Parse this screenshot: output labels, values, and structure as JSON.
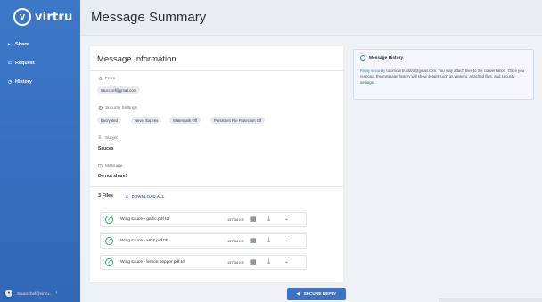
{
  "brand": {
    "logo_letter": "v",
    "logo_text": "virtru"
  },
  "sidebar": {
    "items": [
      {
        "icon": "share-icon",
        "glyph": "▸",
        "label": "Share"
      },
      {
        "icon": "inbox-icon",
        "glyph": "▭",
        "label": "Request"
      },
      {
        "icon": "history-icon",
        "glyph": "◷",
        "label": "History"
      }
    ],
    "user": {
      "label": "Saucechef@virtru...",
      "chevron": "›"
    }
  },
  "header": {
    "title": "Message Summary"
  },
  "message": {
    "title": "Message Information",
    "from_label": "From",
    "from_value": "saucchef@gmail.com",
    "security_label": "Security Settings",
    "security_chips": [
      "Encrypted",
      "Never Expires",
      "Watermark Off",
      "Persistent File Protection Off"
    ],
    "subject_label": "Subject",
    "subject_value": "Sauces",
    "message_label": "Message",
    "message_value": "Do not share!"
  },
  "files": {
    "count_label": "3 Files",
    "download_all": "DOWNLOAD ALL",
    "items": [
      {
        "name": "Wing sauce - garlic.pdf.tdf",
        "size": "157.36 KB"
      },
      {
        "name": "Wing sauce - HOT.pdf.tdf",
        "size": "157.36 KB"
      },
      {
        "name": "Wing sauce - lemon pepper.pdf.tdf",
        "size": "157.36 KB"
      }
    ]
  },
  "reply": {
    "label": "SECURE REPLY"
  },
  "history": {
    "title": "Message History",
    "link_text": "Reply securely",
    "body": " to omcvirtrustant@gmail.com. You may attach files to the conversation. Once you respond, the message history will show details such as viewers, attached files, and security settings."
  },
  "colors": {
    "accent": "#3d72c7",
    "sidebar": "#3268b6",
    "success": "#2fa56a"
  }
}
